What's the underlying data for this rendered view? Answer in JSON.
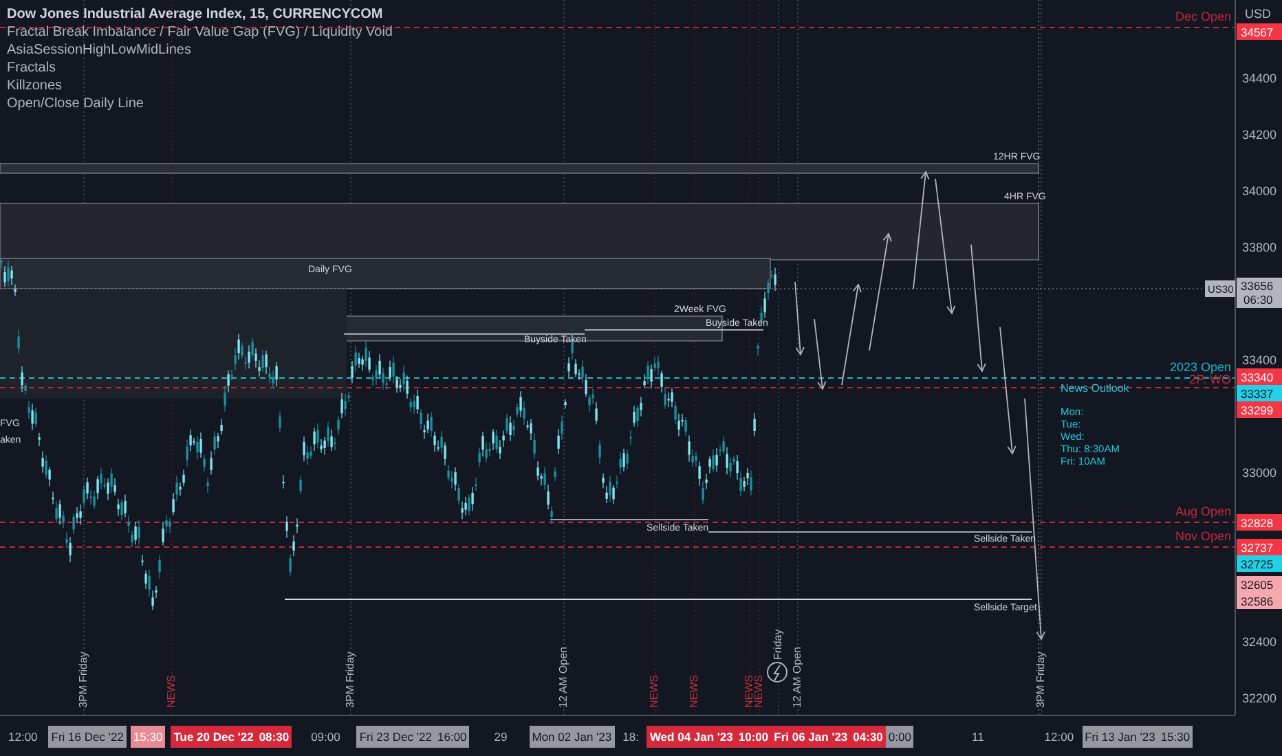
{
  "legend": {
    "title": "Dow Jones Industrial Average Index, 15, CURRENCYCOM",
    "indicators": [
      "Fractal Break Imbalance / Fair Value Gap (FVG) / Liquidity Void",
      "AsiaSessionHighLowMidLines",
      "Fractals",
      "Killzones",
      "Open/Close Daily Line"
    ]
  },
  "price_axis": {
    "currency": "USD",
    "ticks": [
      "34400",
      "34200",
      "34000",
      "33800",
      "33400",
      "33000",
      "32400",
      "32200"
    ]
  },
  "symbol_tag": "US30",
  "price_labels": [
    {
      "text": "34567",
      "color": "#f23645"
    },
    {
      "text": "33656",
      "time": "06:30",
      "color": "#b2b5be"
    },
    {
      "text": "33340",
      "color": "#f23645"
    },
    {
      "text": "33337",
      "color": "#22d1e6"
    },
    {
      "text": "33299",
      "color": "#f23645"
    },
    {
      "text": "32828",
      "color": "#f23645"
    },
    {
      "text": "32737",
      "color": "#f23645"
    },
    {
      "text": "32725",
      "color": "#22d1e6"
    },
    {
      "text": "32605",
      "color": "#f7a8ae"
    },
    {
      "text": "32586",
      "color": "#f7a8ae"
    }
  ],
  "level_lines": [
    {
      "label": "Dec Open",
      "color": "#c2283a"
    },
    {
      "label": "2023 Open",
      "color": "#1fb5c6"
    },
    {
      "label": "2P. WO",
      "color": "#c2283a"
    },
    {
      "label": "Aug Open",
      "color": "#c2283a"
    },
    {
      "label": "Nov Open",
      "color": "#c2283a"
    }
  ],
  "zone_labels": [
    "12HR FVG",
    "4HR FVG",
    "Daily FVG",
    "2Week FVG",
    "Buyside Taken",
    "Buyside Taken",
    "Sellside Taken",
    "Sellside Taken",
    "Sellside Target",
    "FVG",
    "aken"
  ],
  "news_outlook": {
    "title": "News Outlook",
    "lines": [
      "Mon:",
      "Tue:",
      "Wed:",
      "Thu: 8:30AM",
      "Fri: 10AM"
    ]
  },
  "session_markers": [
    {
      "text": "3PM Friday",
      "kind": "session"
    },
    {
      "text": "NEWS",
      "kind": "news"
    },
    {
      "text": "3PM Friday",
      "kind": "session"
    },
    {
      "text": "12 AM Open",
      "kind": "session"
    },
    {
      "text": "NEWS",
      "kind": "news"
    },
    {
      "text": "NEWS",
      "kind": "news"
    },
    {
      "text": "NEWS",
      "kind": "news"
    },
    {
      "text": "NEWS",
      "kind": "news"
    },
    {
      "text": "Friday",
      "kind": "session"
    },
    {
      "text": "12 AM Open",
      "kind": "session"
    },
    {
      "text": "3PM Friday",
      "kind": "session"
    }
  ],
  "time_axis": [
    {
      "text": "12:00",
      "kind": "plain"
    },
    {
      "text": "Fri 16 Dec '22",
      "kind": "date"
    },
    {
      "text": "15:30",
      "kind": "soft"
    },
    {
      "text": "Tue 20 Dec '22",
      "kind": "event"
    },
    {
      "text": "08:30",
      "kind": "event"
    },
    {
      "text": "09:00",
      "kind": "plain"
    },
    {
      "text": "Fri 23 Dec '22",
      "kind": "date"
    },
    {
      "text": "16:00",
      "kind": "date"
    },
    {
      "text": "29",
      "kind": "plain"
    },
    {
      "text": "Mon 02 Jan '23",
      "kind": "date"
    },
    {
      "text": "18:",
      "kind": "plain"
    },
    {
      "text": "Wed 04 Jan '23",
      "kind": "event"
    },
    {
      "text": "10:00",
      "kind": "event"
    },
    {
      "text": "Fri 06 Jan '23",
      "kind": "event"
    },
    {
      "text": "04:30",
      "kind": "event"
    },
    {
      "text": "0:00",
      "kind": "date"
    },
    {
      "text": "11",
      "kind": "plain"
    },
    {
      "text": "12:00",
      "kind": "plain"
    },
    {
      "text": "Fri 13 Jan '23",
      "kind": "date"
    },
    {
      "text": "15:30",
      "kind": "date"
    }
  ]
}
